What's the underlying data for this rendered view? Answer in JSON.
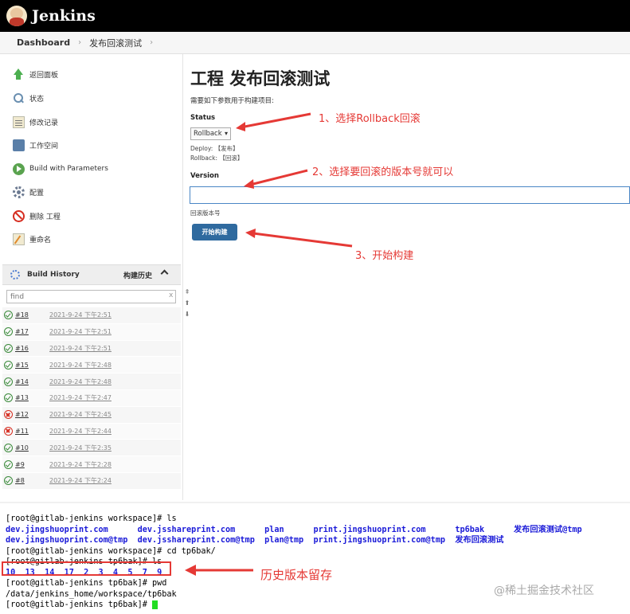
{
  "header": {
    "brand": "Jenkins"
  },
  "breadcrumb": {
    "root": "Dashboard",
    "job": "发布回滚测试"
  },
  "sidebar": {
    "tasks": [
      {
        "label": "返回面板",
        "icon": "arrow-up-icon"
      },
      {
        "label": "状态",
        "icon": "search-icon"
      },
      {
        "label": "修改记录",
        "icon": "notepad-icon"
      },
      {
        "label": "工作空间",
        "icon": "folder-icon"
      },
      {
        "label": "Build with Parameters",
        "icon": "build-icon"
      },
      {
        "label": "配置",
        "icon": "gear-icon"
      },
      {
        "label": "删除 工程",
        "icon": "no-entry-icon"
      },
      {
        "label": "重命名",
        "icon": "rename-icon"
      }
    ],
    "build_history": {
      "title": "Build History",
      "title_cn": "构建历史",
      "find_placeholder": "find",
      "find_clear": "x",
      "builds": [
        {
          "num": "#18",
          "date": "2021-9-24 下午2:51",
          "status": "success"
        },
        {
          "num": "#17",
          "date": "2021-9-24 下午2:51",
          "status": "success"
        },
        {
          "num": "#16",
          "date": "2021-9-24 下午2:51",
          "status": "success"
        },
        {
          "num": "#15",
          "date": "2021-9-24 下午2:48",
          "status": "success"
        },
        {
          "num": "#14",
          "date": "2021-9-24 下午2:48",
          "status": "success"
        },
        {
          "num": "#13",
          "date": "2021-9-24 下午2:47",
          "status": "success"
        },
        {
          "num": "#12",
          "date": "2021-9-24 下午2:45",
          "status": "failed"
        },
        {
          "num": "#11",
          "date": "2021-9-24 下午2:44",
          "status": "failed"
        },
        {
          "num": "#10",
          "date": "2021-9-24 下午2:35",
          "status": "success"
        },
        {
          "num": "#9",
          "date": "2021-9-24 下午2:28",
          "status": "success"
        },
        {
          "num": "#8",
          "date": "2021-9-24 下午2:24",
          "status": "success"
        }
      ]
    }
  },
  "main": {
    "title": "工程 发布回滚测试",
    "description": "需要如下参数用于构建项目:",
    "status_label": "Status",
    "status_value": "Rollback",
    "status_hint_deploy": "Deploy: 【发布】",
    "status_hint_rollback": "Rollback: 【回滚】",
    "version_label": "Version",
    "version_value": "",
    "version_hint": "回滚版本号",
    "build_button": "开始构建"
  },
  "annotations": {
    "step1": "1、选择Rollback回滚",
    "step2": "2、选择要回滚的版本号就可以",
    "step3": "3、开始构建",
    "history": "历史版本留存",
    "color": "#e53935"
  },
  "terminal": {
    "line1": "[root@gitlab-jenkins workspace]# ls",
    "ls_row1": [
      "dev.jingshuoprint.com",
      "dev.jsshareprint.com",
      "plan",
      "print.jingshuoprint.com",
      "tp6bak",
      "发布回滚测试@tmp"
    ],
    "ls_row2": [
      "dev.jingshuoprint.com@tmp",
      "dev.jsshareprint.com@tmp",
      "plan@tmp",
      "print.jingshuoprint.com@tmp",
      "发布回滚测试"
    ],
    "line4": "[root@gitlab-jenkins workspace]# cd tp6bak/",
    "line5": "[root@gitlab-jenkins tp6bak]# ls",
    "versions": "10  13  14  17  2  3  4  5  7  9",
    "line7": "[root@gitlab-jenkins tp6bak]# pwd",
    "line8": "/data/jenkins_home/workspace/tp6bak",
    "line9": "[root@gitlab-jenkins tp6bak]# "
  },
  "watermark": "@稀土掘金技术社区"
}
